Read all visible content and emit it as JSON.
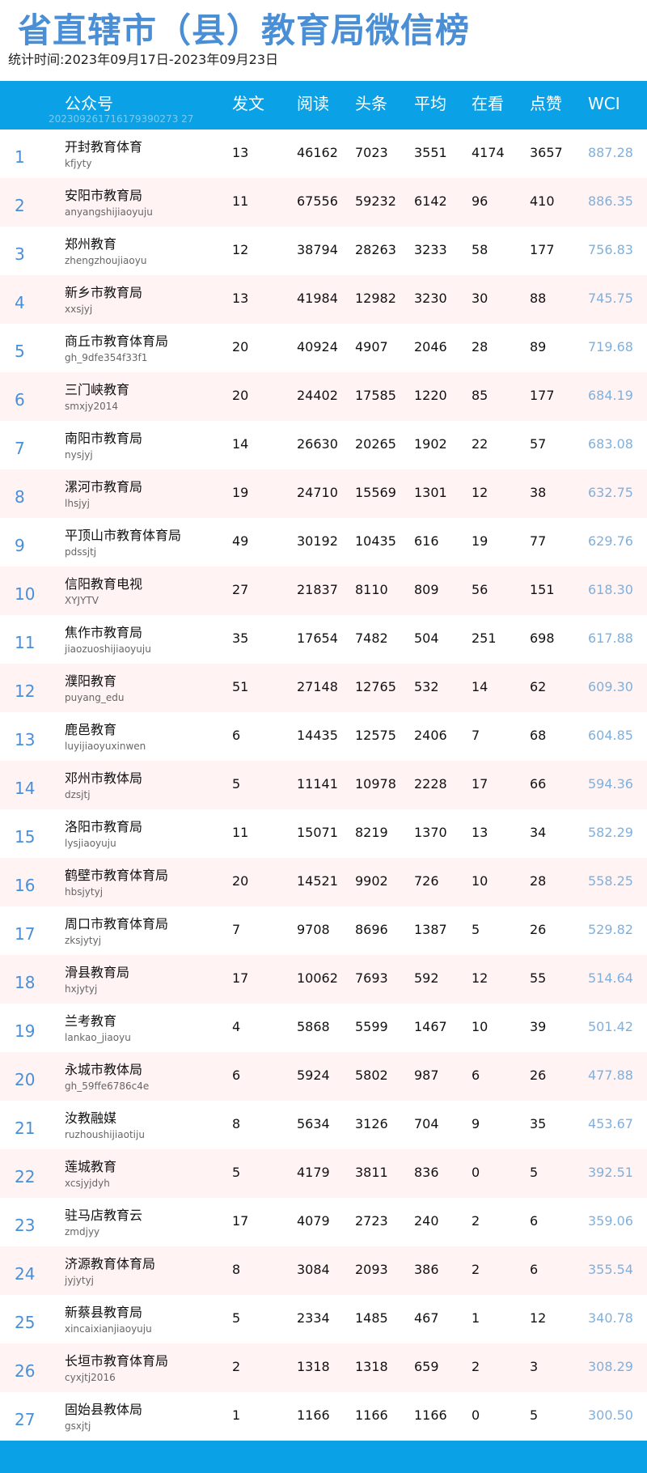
{
  "title": "省直辖市（县）教育局微信榜",
  "subtitle": "统计时间:2023年09月17日-2023年09月23日",
  "header": {
    "cols": [
      "公众号",
      "发文",
      "阅读",
      "头条",
      "平均",
      "在看",
      "点赞",
      "WCI"
    ],
    "watermark": "202309261716179390273 27"
  },
  "rows": [
    {
      "rank": "1",
      "name": "开封教育体育",
      "acct": "kfjyty",
      "fw": "13",
      "yd": "46162",
      "tt": "7023",
      "pj": "3551",
      "zk": "4174",
      "dz": "3657",
      "wci": "887.28"
    },
    {
      "rank": "2",
      "name": "安阳市教育局",
      "acct": "anyangshijiaoyuju",
      "fw": "11",
      "yd": "67556",
      "tt": "59232",
      "pj": "6142",
      "zk": "96",
      "dz": "410",
      "wci": "886.35"
    },
    {
      "rank": "3",
      "name": "郑州教育",
      "acct": "zhengzhoujiaoyu",
      "fw": "12",
      "yd": "38794",
      "tt": "28263",
      "pj": "3233",
      "zk": "58",
      "dz": "177",
      "wci": "756.83"
    },
    {
      "rank": "4",
      "name": "新乡市教育局",
      "acct": "xxsjyj",
      "fw": "13",
      "yd": "41984",
      "tt": "12982",
      "pj": "3230",
      "zk": "30",
      "dz": "88",
      "wci": "745.75"
    },
    {
      "rank": "5",
      "name": "商丘市教育体育局",
      "acct": "gh_9dfe354f33f1",
      "fw": "20",
      "yd": "40924",
      "tt": "4907",
      "pj": "2046",
      "zk": "28",
      "dz": "89",
      "wci": "719.68"
    },
    {
      "rank": "6",
      "name": "三门峡教育",
      "acct": "smxjy2014",
      "fw": "20",
      "yd": "24402",
      "tt": "17585",
      "pj": "1220",
      "zk": "85",
      "dz": "177",
      "wci": "684.19"
    },
    {
      "rank": "7",
      "name": "南阳市教育局",
      "acct": "nysjyj",
      "fw": "14",
      "yd": "26630",
      "tt": "20265",
      "pj": "1902",
      "zk": "22",
      "dz": "57",
      "wci": "683.08"
    },
    {
      "rank": "8",
      "name": "漯河市教育局",
      "acct": "lhsjyj",
      "fw": "19",
      "yd": "24710",
      "tt": "15569",
      "pj": "1301",
      "zk": "12",
      "dz": "38",
      "wci": "632.75"
    },
    {
      "rank": "9",
      "name": "平顶山市教育体育局",
      "acct": "pdssjtj",
      "fw": "49",
      "yd": "30192",
      "tt": "10435",
      "pj": "616",
      "zk": "19",
      "dz": "77",
      "wci": "629.76"
    },
    {
      "rank": "10",
      "name": "信阳教育电视",
      "acct": "XYJYTV",
      "fw": "27",
      "yd": "21837",
      "tt": "8110",
      "pj": "809",
      "zk": "56",
      "dz": "151",
      "wci": "618.30"
    },
    {
      "rank": "11",
      "name": "焦作市教育局",
      "acct": "jiaozuoshijiaoyuju",
      "fw": "35",
      "yd": "17654",
      "tt": "7482",
      "pj": "504",
      "zk": "251",
      "dz": "698",
      "wci": "617.88"
    },
    {
      "rank": "12",
      "name": "濮阳教育",
      "acct": "puyang_edu",
      "fw": "51",
      "yd": "27148",
      "tt": "12765",
      "pj": "532",
      "zk": "14",
      "dz": "62",
      "wci": "609.30"
    },
    {
      "rank": "13",
      "name": "鹿邑教育",
      "acct": "luyijiaoyuxinwen",
      "fw": "6",
      "yd": "14435",
      "tt": "12575",
      "pj": "2406",
      "zk": "7",
      "dz": "68",
      "wci": "604.85"
    },
    {
      "rank": "14",
      "name": "邓州市教体局",
      "acct": "dzsjtj",
      "fw": "5",
      "yd": "11141",
      "tt": "10978",
      "pj": "2228",
      "zk": "17",
      "dz": "66",
      "wci": "594.36"
    },
    {
      "rank": "15",
      "name": "洛阳市教育局",
      "acct": "lysjiaoyuju",
      "fw": "11",
      "yd": "15071",
      "tt": "8219",
      "pj": "1370",
      "zk": "13",
      "dz": "34",
      "wci": "582.29"
    },
    {
      "rank": "16",
      "name": "鹤壁市教育体育局",
      "acct": "hbsjytyj",
      "fw": "20",
      "yd": "14521",
      "tt": "9902",
      "pj": "726",
      "zk": "10",
      "dz": "28",
      "wci": "558.25"
    },
    {
      "rank": "17",
      "name": "周口市教育体育局",
      "acct": "zksjytyj",
      "fw": "7",
      "yd": "9708",
      "tt": "8696",
      "pj": "1387",
      "zk": "5",
      "dz": "26",
      "wci": "529.82"
    },
    {
      "rank": "18",
      "name": "滑县教育局",
      "acct": "hxjytyj",
      "fw": "17",
      "yd": "10062",
      "tt": "7693",
      "pj": "592",
      "zk": "12",
      "dz": "55",
      "wci": "514.64"
    },
    {
      "rank": "19",
      "name": "兰考教育",
      "acct": "lankao_jiaoyu",
      "fw": "4",
      "yd": "5868",
      "tt": "5599",
      "pj": "1467",
      "zk": "10",
      "dz": "39",
      "wci": "501.42"
    },
    {
      "rank": "20",
      "name": "永城市教体局",
      "acct": "gh_59ffe6786c4e",
      "fw": "6",
      "yd": "5924",
      "tt": "5802",
      "pj": "987",
      "zk": "6",
      "dz": "26",
      "wci": "477.88"
    },
    {
      "rank": "21",
      "name": "汝教融媒",
      "acct": "ruzhoushijiaotiju",
      "fw": "8",
      "yd": "5634",
      "tt": "3126",
      "pj": "704",
      "zk": "9",
      "dz": "35",
      "wci": "453.67"
    },
    {
      "rank": "22",
      "name": "莲城教育",
      "acct": "xcsjyjdyh",
      "fw": "5",
      "yd": "4179",
      "tt": "3811",
      "pj": "836",
      "zk": "0",
      "dz": "5",
      "wci": "392.51"
    },
    {
      "rank": "23",
      "name": "驻马店教育云",
      "acct": "zmdjyy",
      "fw": "17",
      "yd": "4079",
      "tt": "2723",
      "pj": "240",
      "zk": "2",
      "dz": "6",
      "wci": "359.06"
    },
    {
      "rank": "24",
      "name": "济源教育体育局",
      "acct": "jyjytyj",
      "fw": "8",
      "yd": "3084",
      "tt": "2093",
      "pj": "386",
      "zk": "2",
      "dz": "6",
      "wci": "355.54"
    },
    {
      "rank": "25",
      "name": "新蔡县教育局",
      "acct": "xincaixianjiaoyuju",
      "fw": "5",
      "yd": "2334",
      "tt": "1485",
      "pj": "467",
      "zk": "1",
      "dz": "12",
      "wci": "340.78"
    },
    {
      "rank": "26",
      "name": "长垣市教育体育局",
      "acct": "cyxjtj2016",
      "fw": "2",
      "yd": "1318",
      "tt": "1318",
      "pj": "659",
      "zk": "2",
      "dz": "3",
      "wci": "308.29"
    },
    {
      "rank": "27",
      "name": "固始县教体局",
      "acct": "gsxjtj",
      "fw": "1",
      "yd": "1166",
      "tt": "1166",
      "pj": "1166",
      "zk": "0",
      "dz": "5",
      "wci": "300.50"
    }
  ]
}
